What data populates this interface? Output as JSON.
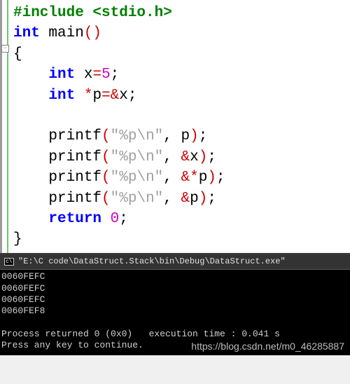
{
  "code": {
    "l1_include": "#include <stdio.h>",
    "l2_kw": "int",
    "l2_fn": " main",
    "l2_paren": "()",
    "l3_brace": "{",
    "l4_kw": "int",
    "l4_sp": " x",
    "l4_op": "=",
    "l4_num": "5",
    "l4_end": ";",
    "l5_kw": "int",
    "l5_sp": " ",
    "l5_op1": "*",
    "l5_var": "p",
    "l5_op2": "=&",
    "l5_var2": "x",
    "l5_end": ";",
    "p1_fn": "printf",
    "p1_po": "(",
    "p1_str": "\"%p\\n\"",
    "p1_c": ",",
    "p1_arg": " p",
    "p1_pc": ")",
    "p1_end": ";",
    "p2_fn": "printf",
    "p2_po": "(",
    "p2_str": "\"%p\\n\"",
    "p2_c": ",",
    "p2_op": " &",
    "p2_arg": "x",
    "p2_pc": ")",
    "p2_end": ";",
    "p3_fn": "printf",
    "p3_po": "(",
    "p3_str": "\"%p\\n\"",
    "p3_c": ",",
    "p3_op": " &*",
    "p3_arg": "p",
    "p3_pc": ")",
    "p3_end": ";",
    "p4_fn": "printf",
    "p4_po": "(",
    "p4_str": "\"%p\\n\"",
    "p4_c": ",",
    "p4_op": " &",
    "p4_arg": "p",
    "p4_pc": ")",
    "p4_end": ";",
    "ret_kw": "return",
    "ret_sp": " ",
    "ret_num": "0",
    "ret_end": ";",
    "close_brace": "}"
  },
  "console": {
    "title": "\"E:\\C code\\DataStruct.Stack\\bin\\Debug\\DataStruct.exe\"",
    "out1": "0060FEFC",
    "out2": "0060FEFC",
    "out3": "0060FEFC",
    "out4": "0060FEF8",
    "status": "Process returned 0 (0x0)   execution time : 0.041 s",
    "prompt": "Press any key to continue."
  },
  "watermark": "https://blog.csdn.net/m0_46285887"
}
